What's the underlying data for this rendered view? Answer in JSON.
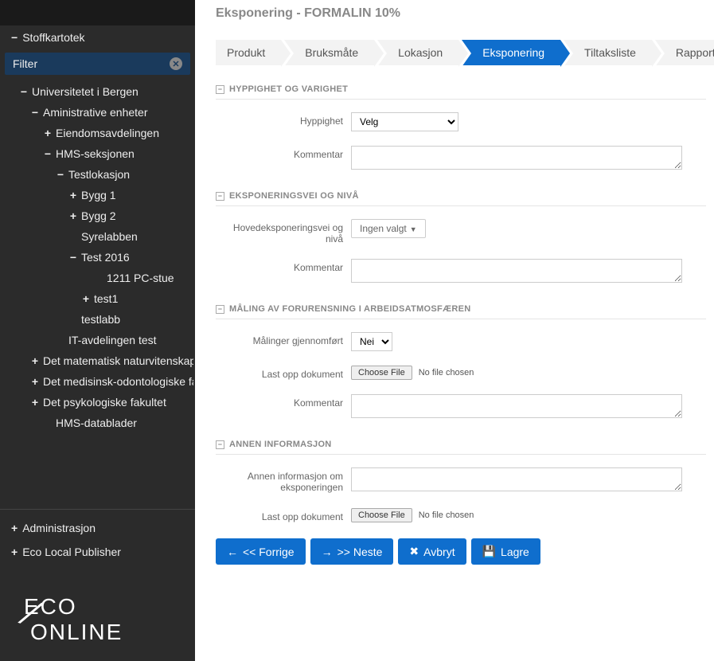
{
  "sidebar": {
    "top_item": {
      "sym": "−",
      "label": "Stoffkartotek"
    },
    "filter_label": "Filter",
    "tree": [
      {
        "cls": "t1",
        "sym": "−",
        "label": "Universitetet i Bergen"
      },
      {
        "cls": "t2",
        "sym": "−",
        "label": "Aministrative enheter"
      },
      {
        "cls": "t3",
        "sym": "+",
        "label": "Eiendomsavdelingen"
      },
      {
        "cls": "t3",
        "sym": "−",
        "label": "HMS-seksjonen"
      },
      {
        "cls": "t4",
        "sym": "−",
        "label": "Testlokasjon"
      },
      {
        "cls": "t5",
        "sym": "+",
        "label": "Bygg 1"
      },
      {
        "cls": "t5",
        "sym": "+",
        "label": "Bygg 2"
      },
      {
        "cls": "t5",
        "sym": "",
        "label": "Syrelabben"
      },
      {
        "cls": "t5",
        "sym": "−",
        "label": "Test 2016"
      },
      {
        "cls": "t7",
        "sym": "",
        "label": "1211 PC-stue"
      },
      {
        "cls": "t6",
        "sym": "+",
        "label": "test1"
      },
      {
        "cls": "t5",
        "sym": "",
        "label": "testlabb"
      },
      {
        "cls": "t4",
        "sym": "",
        "label": "IT-avdelingen test"
      },
      {
        "cls": "t2",
        "sym": "+",
        "label": "Det matematisk naturvitenskapelige fak"
      },
      {
        "cls": "t2",
        "sym": "+",
        "label": "Det medisinsk-odontologiske fakultet"
      },
      {
        "cls": "t2",
        "sym": "+",
        "label": "Det psykologiske fakultet"
      },
      {
        "cls": "t3",
        "sym": "",
        "label": "HMS-datablader"
      }
    ],
    "bottom": [
      {
        "sym": "+",
        "label": "Administrasjon"
      },
      {
        "sym": "+",
        "label": "Eco Local Publisher"
      }
    ],
    "logo_line1": "ECO",
    "logo_line2": "ONLINE"
  },
  "main": {
    "title": "Eksponering - FORMALIN 10%",
    "bc": [
      {
        "label": "Produkt",
        "active": false
      },
      {
        "label": "Bruksmåte",
        "active": false
      },
      {
        "label": "Lokasjon",
        "active": false
      },
      {
        "label": "Eksponering",
        "active": true
      },
      {
        "label": "Tiltaksliste",
        "active": false
      },
      {
        "label": "Rapport",
        "active": false
      }
    ],
    "sec1": {
      "title": "HYPPIGHET OG VARIGHET",
      "row1_label": "Hyppighet",
      "row1_value": "Velg",
      "row2_label": "Kommentar"
    },
    "sec2": {
      "title": "EKSPONERINGSVEI OG NIVÅ",
      "row1_label": "Hovedeksponeringsvei og nivå",
      "row1_value": "Ingen valgt",
      "row2_label": "Kommentar"
    },
    "sec3": {
      "title": "MÅLING AV FORURENSNING I ARBEIDSATMOSFÆREN",
      "row1_label": "Målinger gjennomført",
      "row1_value": "Nei",
      "row2_label": "Last opp dokument",
      "row2_btn": "Choose File",
      "row2_txt": "No file chosen",
      "row3_label": "Kommentar"
    },
    "sec4": {
      "title": "ANNEN INFORMASJON",
      "row1_label": "Annen informasjon om eksponeringen",
      "row2_label": "Last opp dokument",
      "row2_btn": "Choose File",
      "row2_txt": "No file chosen"
    },
    "actions": {
      "prev": "<< Forrige",
      "next": ">> Neste",
      "cancel": "Avbryt",
      "save": "Lagre"
    }
  }
}
